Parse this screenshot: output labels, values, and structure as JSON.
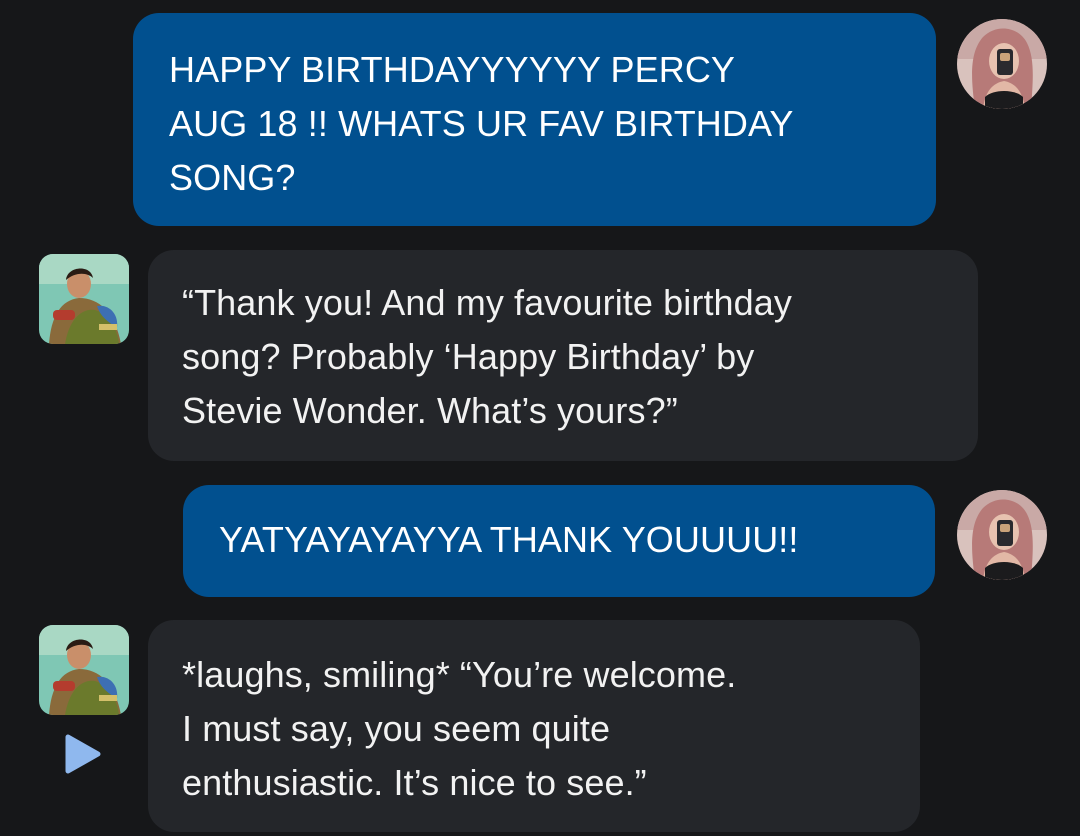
{
  "messages": [
    {
      "sender": "user",
      "text": "HAPPY BIRTHDAYYYYYY PERCY\nAUG 18 !! WHATS UR FAV BIRTHDAY\nSONG?"
    },
    {
      "sender": "bot",
      "text": "“Thank you! And my favourite birthday\nsong? Probably ‘Happy Birthday’ by\nStevie Wonder. What’s yours?”"
    },
    {
      "sender": "user",
      "text": "YATYAYAYAYYA THANK YOUUUU!!"
    },
    {
      "sender": "bot",
      "text": "*laughs, smiling* “You’re welcome.\nI must say, you seem quite\nenthusiastic. It’s nice to see.”"
    }
  ],
  "icons": {
    "user_avatar": "user-avatar-icon",
    "bot_avatar": "character-avatar-icon",
    "play": "play-icon"
  },
  "colors": {
    "background": "#161719",
    "user_bubble": "#01508f",
    "bot_bubble": "#24262a",
    "play_button": "#8fb8ee"
  }
}
